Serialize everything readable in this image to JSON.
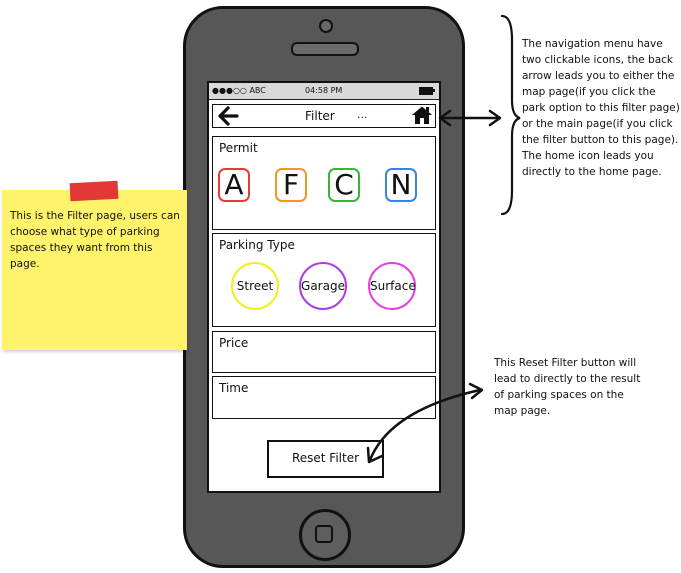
{
  "status_bar": {
    "carrier": "●●●○○ ABC",
    "time": "04:58 PM",
    "battery": "",
    "battery_icon": "battery-icon"
  },
  "nav_bar": {
    "back_icon": "back-arrow-icon",
    "title": "Filter",
    "dots": "...",
    "home_icon": "home-icon"
  },
  "permit": {
    "label": "Permit",
    "options": [
      {
        "letter": "A",
        "color": "#e53b3b"
      },
      {
        "letter": "F",
        "color": "#f5961f"
      },
      {
        "letter": "C",
        "color": "#3bb33b"
      },
      {
        "letter": "N",
        "color": "#3b82e5"
      }
    ]
  },
  "parking_type": {
    "label": "Parking Type",
    "options": [
      {
        "label": "Street",
        "color": "#f2ee1f"
      },
      {
        "label": "Garage",
        "color": "#b13de0"
      },
      {
        "label": "Surface",
        "color": "#e040e0"
      }
    ]
  },
  "price": {
    "label": "Price"
  },
  "time": {
    "label": "Time"
  },
  "reset_button": {
    "label": "Reset Filter"
  },
  "sticky_note": {
    "text": "This is the Filter page, users can choose what type of parking spaces they want from this page.",
    "color": "#fff36b",
    "tape_color": "#e43838"
  },
  "annotations": {
    "navigation": "The navigation menu have two clickable icons, the back arrow leads you to either the map page(if you click the park option to this filter page) or the main page(if you click the filter button to this page). The home icon leads you directly to the home page.",
    "reset": "This Reset Filter button will lead to directly to the result of parking spaces on the map page."
  },
  "colors": {
    "phone_body": "#575757",
    "phone_outline": "#111111"
  }
}
